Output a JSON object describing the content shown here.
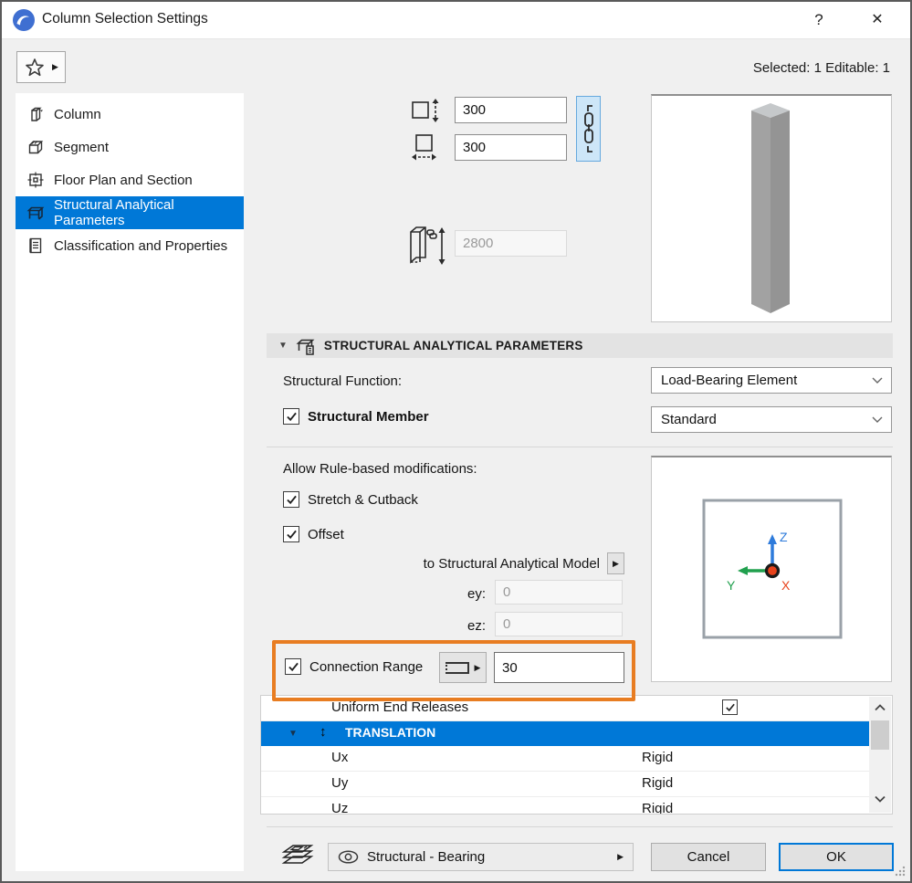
{
  "colors": {
    "accent_blue": "#0078d7",
    "highlight_orange": "#e87d22",
    "link_button_bg": "#cde6f8",
    "column_gray": "#9c9c9c",
    "axis_x_red": "#e8431c",
    "axis_y_green": "#21a04e",
    "axis_z_blue": "#2e7bdb"
  },
  "window": {
    "title": "Column Selection Settings",
    "help_label": "?",
    "close_label": "✕"
  },
  "header": {
    "selected_info": "Selected: 1 Editable: 1"
  },
  "sidebar": {
    "items": [
      {
        "label": "Column",
        "selected": false
      },
      {
        "label": "Segment",
        "selected": false
      },
      {
        "label": "Floor Plan and Section",
        "selected": false
      },
      {
        "label": "Structural Analytical Parameters",
        "selected": true
      },
      {
        "label": "Classification and Properties",
        "selected": false
      }
    ]
  },
  "geometry": {
    "core_height_value": "300",
    "core_width_value": "300",
    "column_height_value": "2800"
  },
  "analytical": {
    "section_title": "STRUCTURAL ANALYTICAL PARAMETERS",
    "function_label": "Structural Function:",
    "function_value": "Load-Bearing Element",
    "member_checkbox_label": "Structural Member",
    "member_value": "Standard",
    "rules_label": "Allow Rule-based modifications:",
    "stretch_checkbox_label": "Stretch & Cutback",
    "offset_checkbox_label": "Offset",
    "to_model_label": "to Structural Analytical Model",
    "ey_label": "ey:",
    "ey_value": "0",
    "ez_label": "ez:",
    "ez_value": "0",
    "connection_checkbox_label": "Connection Range",
    "connection_value": "30"
  },
  "axes_preview": {
    "x_label": "X",
    "y_label": "Y",
    "z_label": "Z"
  },
  "releases_table": {
    "rows": [
      {
        "label": "Uniform End Releases",
        "checked": true
      },
      {
        "label": "TRANSLATION",
        "group": true
      },
      {
        "label": "Ux",
        "value": "Rigid"
      },
      {
        "label": "Uy",
        "value": "Rigid"
      },
      {
        "label": "Uz",
        "value": "Rigid"
      }
    ]
  },
  "footer": {
    "layer_value": "Structural - Bearing",
    "cancel_label": "Cancel",
    "ok_label": "OK"
  },
  "icons": {
    "flyout_arrow": "▶",
    "translation_collapse": "▼",
    "translation_axis": "↕",
    "section_collapse": "▼"
  }
}
